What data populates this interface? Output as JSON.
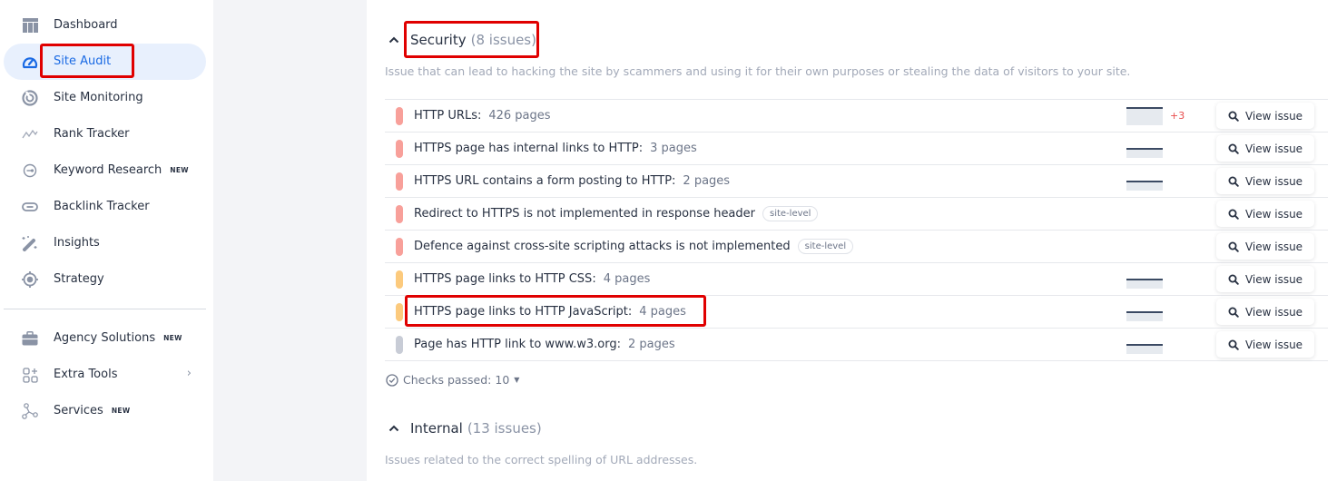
{
  "sidebar": {
    "items": [
      {
        "label": "Dashboard",
        "icon": "dashboard-icon",
        "active": false,
        "badge": ""
      },
      {
        "label": "Site Audit",
        "icon": "gauge-icon",
        "active": true,
        "badge": ""
      },
      {
        "label": "Site Monitoring",
        "icon": "radar-icon",
        "active": false,
        "badge": ""
      },
      {
        "label": "Rank Tracker",
        "icon": "trend-line-icon",
        "active": false,
        "badge": ""
      },
      {
        "label": "Keyword Research",
        "icon": "keyword-icon",
        "active": false,
        "badge": "NEW"
      },
      {
        "label": "Backlink Tracker",
        "icon": "link-icon",
        "active": false,
        "badge": ""
      },
      {
        "label": "Insights",
        "icon": "magic-wand-icon",
        "active": false,
        "badge": ""
      },
      {
        "label": "Strategy",
        "icon": "target-icon",
        "active": false,
        "badge": ""
      }
    ],
    "secondary_items": [
      {
        "label": "Agency Solutions",
        "icon": "briefcase-icon",
        "badge": "NEW"
      },
      {
        "label": "Extra Tools",
        "icon": "extra-tools-icon",
        "badge": "",
        "chevron": "›"
      },
      {
        "label": "Services",
        "icon": "services-icon",
        "badge": "NEW"
      }
    ]
  },
  "security_section": {
    "title": "Security",
    "count": "(8 issues)",
    "description": "Issue that can lead to hacking the site by scammers and using it for their own purposes or stealing the data of visitors to your site.",
    "issues": [
      {
        "title": "HTTP URLs:",
        "pages": "426 pages",
        "severity": "error",
        "color": "#f8a09a",
        "site_level": "",
        "has_trend": true,
        "delta": "+3"
      },
      {
        "title": "HTTPS page has internal links to HTTP:",
        "pages": "3 pages",
        "severity": "error",
        "color": "#f8a09a",
        "site_level": "",
        "has_trend": true,
        "delta": ""
      },
      {
        "title": "HTTPS URL contains a form posting to HTTP:",
        "pages": "2 pages",
        "severity": "error",
        "color": "#f8a09a",
        "site_level": "",
        "has_trend": true,
        "delta": ""
      },
      {
        "title": "Redirect to HTTPS is not implemented in response header",
        "pages": "",
        "severity": "error",
        "color": "#f8a09a",
        "site_level": "site-level",
        "has_trend": false,
        "delta": ""
      },
      {
        "title": "Defence against cross-site scripting attacks is not implemented",
        "pages": "",
        "severity": "error",
        "color": "#f8a09a",
        "site_level": "site-level",
        "has_trend": false,
        "delta": ""
      },
      {
        "title": "HTTPS page links to HTTP CSS:",
        "pages": "4 pages",
        "severity": "warning",
        "color": "#fcca7d",
        "site_level": "",
        "has_trend": true,
        "delta": ""
      },
      {
        "title": "HTTPS page links to HTTP JavaScript:",
        "pages": "4 pages",
        "severity": "warning",
        "color": "#fcca7d",
        "site_level": "",
        "has_trend": true,
        "delta": ""
      },
      {
        "title": "Page has HTTP link to www.w3.org:",
        "pages": "2 pages",
        "severity": "notice",
        "color": "#c8ccd6",
        "site_level": "",
        "has_trend": true,
        "delta": ""
      }
    ],
    "view_issue_label": "View issue",
    "checks_passed": "Checks passed: 10"
  },
  "internal_section": {
    "title": "Internal",
    "count": "(13 issues)",
    "description": "Issues related to the correct spelling of URL addresses."
  },
  "colors": {
    "accent": "#1a6ae4",
    "active_bg": "#e8f0fd",
    "error": "#f8a09a",
    "warning": "#fcca7d",
    "notice": "#c8ccd6",
    "delta_red": "#e84c4c",
    "highlight": "#e00000"
  }
}
